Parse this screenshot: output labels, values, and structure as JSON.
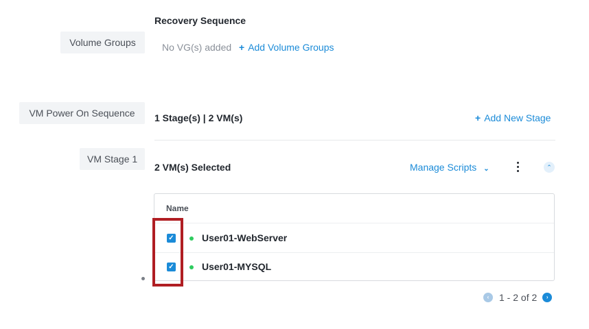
{
  "recovery": {
    "title": "Recovery Sequence",
    "volume_groups_label": "Volume Groups",
    "no_vg_text": "No VG(s) added",
    "add_vg_plus": "+",
    "add_vg_label": "Add Volume Groups"
  },
  "power_on": {
    "label": "VM Power On Sequence",
    "summary": "1 Stage(s) | 2 VM(s)",
    "add_stage_plus": "+",
    "add_stage_label": "Add New Stage"
  },
  "stage": {
    "label": "VM Stage 1",
    "selected_text": "2 VM(s) Selected",
    "manage_scripts_label": "Manage Scripts",
    "chevron_glyph": "⌄",
    "collapse_glyph": "⌃",
    "kebab_icon": "more-vertical-icon",
    "table": {
      "header_name": "Name",
      "rows": [
        {
          "name": "User01-WebServer",
          "checked": true,
          "status_color": "#2fcc5f"
        },
        {
          "name": "User01-MYSQL",
          "checked": true,
          "status_color": "#2fcc5f"
        }
      ]
    }
  },
  "pagination": {
    "range_text": "1 - 2 of 2",
    "prev_glyph": "‹",
    "next_glyph": "›"
  },
  "colors": {
    "accent": "#1b8bd8",
    "highlight_box": "#b01e23",
    "status_ok": "#2fcc5f"
  }
}
